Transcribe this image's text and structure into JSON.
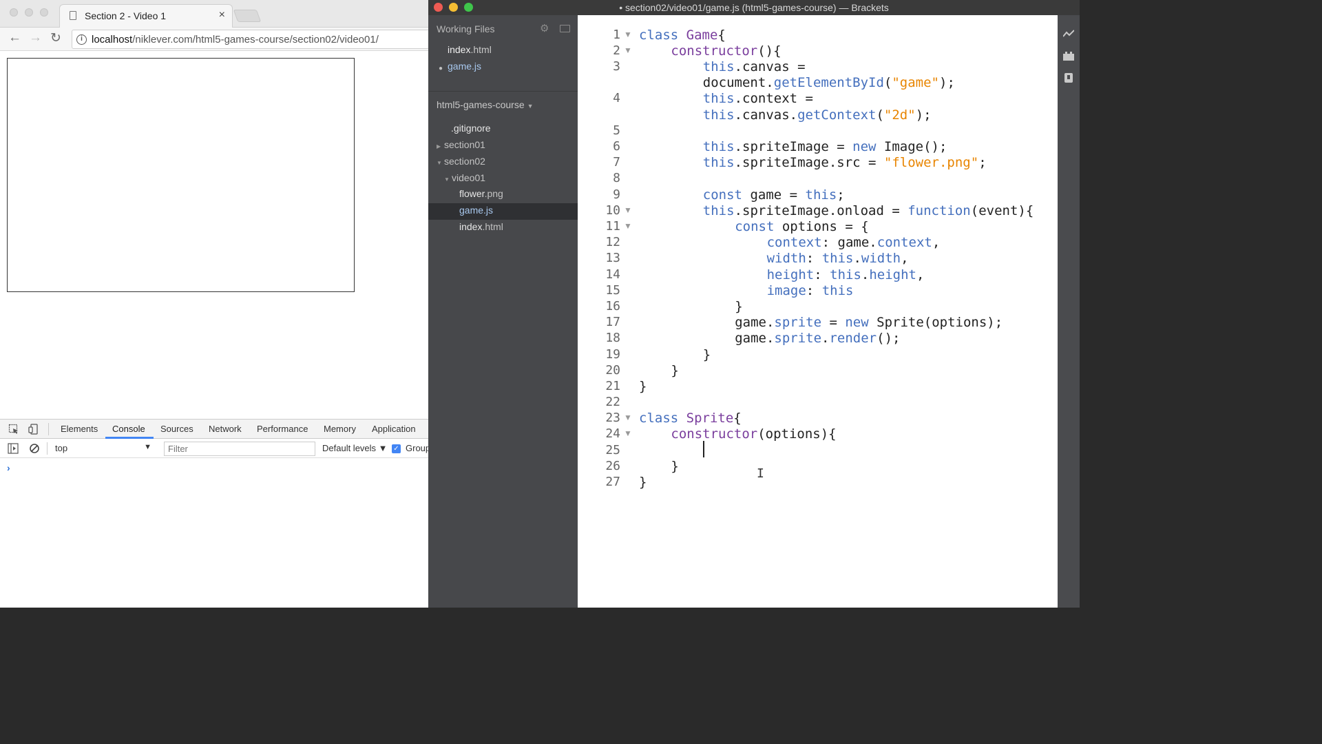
{
  "chrome": {
    "tab_title": "Section 2 - Video 1",
    "tab_close": "×",
    "back": "←",
    "forward": "→",
    "reload": "↻",
    "info": "i",
    "url_host": "localhost",
    "url_path": "/niklever.com/html5-games-course/section02/video01/"
  },
  "devtools": {
    "tabs": [
      "Elements",
      "Console",
      "Sources",
      "Network",
      "Performance",
      "Memory",
      "Application"
    ],
    "context": "top",
    "context_arrow": "▼",
    "filter_placeholder": "Filter",
    "levels": "Default levels ▼",
    "group_check": "✓",
    "group_label": "Group",
    "prompt": "›"
  },
  "brackets": {
    "title": "• section02/video01/game.js (html5-games-course) — Brackets",
    "working_files_header": "Working Files",
    "working_files": [
      {
        "name": "index",
        "ext": ".html"
      },
      {
        "name": "game",
        "ext": ".js"
      }
    ],
    "project_name": "html5-games-course",
    "tree": [
      {
        "name": ".gitignore",
        "ext": ""
      },
      {
        "name": "section01",
        "ext": ""
      },
      {
        "name": "section02",
        "ext": ""
      },
      {
        "name": "video01",
        "ext": ""
      },
      {
        "name": "flower",
        "ext": ".png"
      },
      {
        "name": "game",
        "ext": ".js"
      },
      {
        "name": "index",
        "ext": ".html"
      }
    ],
    "line_numbers": [
      "1",
      "2",
      "3",
      "",
      "4",
      "",
      "5",
      "6",
      "7",
      "8",
      "9",
      "10",
      "11",
      "12",
      "13",
      "14",
      "15",
      "16",
      "17",
      "18",
      "19",
      "20",
      "21",
      "22",
      "23",
      "24",
      "25",
      "26",
      "27"
    ],
    "ibeam": "I"
  },
  "colors": {
    "keyword": "#446fbd",
    "class_name": "#7a3e9d",
    "string": "#e88501",
    "sidebar": "#47484b",
    "mac_close": "#ee5b53",
    "mac_min": "#f5be33",
    "mac_max": "#3fc54b"
  },
  "icons": {
    "tab": "document-icon",
    "settings": "gear-icon",
    "split": "split-view-icon",
    "live_preview": "lightning-icon",
    "extensions": "extension-manager-icon",
    "inspect": "inspect-element-icon",
    "device": "device-toolbar-icon"
  }
}
